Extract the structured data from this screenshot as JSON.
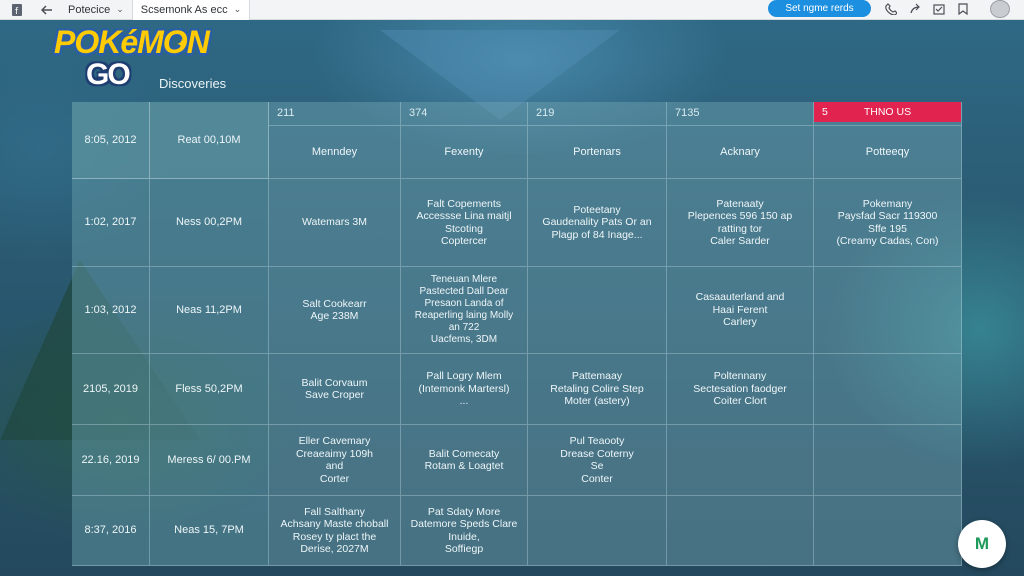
{
  "browser": {
    "tabs": [
      {
        "label": "Potecice"
      },
      {
        "label": "Scsemonk As ecc"
      }
    ],
    "action_label": "Set ngme rerds"
  },
  "logo": {
    "line1": "POKéMON",
    "line2": "GO"
  },
  "page": {
    "title": "Discoveries"
  },
  "table": {
    "top_numbers": [
      "211",
      "374",
      "219",
      "7135"
    ],
    "alert": {
      "number": "5",
      "label": "THNO US"
    },
    "headers": [
      "Menndey",
      "Fexenty",
      "Portenars",
      "Acknary",
      "Potteeqy"
    ],
    "rows": [
      {
        "date": "8:05, 2012",
        "time": "Reat 00,10M",
        "cells": [
          "",
          "",
          "",
          "",
          ""
        ]
      },
      {
        "date": "1:02, 2017",
        "time": "Ness 00,2PM",
        "cells": [
          "Watemars 3M",
          "Falt Copements\nAccessse Lina maitjl\nStcoting\nCoptercer",
          "Poteetany\nGaudenality Pats Or an\nPlagp of 84 Inage...",
          "Patenaaty\nPlepences 596 150 ap\nratting tor\nCaler Sarder",
          "Pokemany\nPaysfad Sacr 119300\nSffe 195\n(Creamy Cadas, Con)"
        ]
      },
      {
        "date": "1:03, 2012",
        "time": "Neas 11,2PM",
        "cells": [
          "Salt Cookearr\nAge 238M",
          "Teneuan Mlere\nPastected Dall Dear\nPresaon Landa of\nReaperling laing Molly\nan 722\nUacfems, 3DM",
          "",
          "Casaauterland and\nHaai Ferent\nCarlery",
          ""
        ]
      },
      {
        "date": "2105, 2019",
        "time": "Fless 50,2PM",
        "cells": [
          "Balit Corvaum\nSave Croper",
          "Pall Logry Mlem\n(Intemonk Martersl)\n...",
          "Pattemaay\nRetaling Colire Step\nMoter (astery)",
          "Poltennany\nSectesation faodger\nCoiter Clort",
          ""
        ]
      },
      {
        "date": "22.16, 2019",
        "time": "Meress 6/ 00.PM",
        "cells": [
          "Eller Cavemary\nCreaeaimy 109h\nand\nCorter",
          "Balit Comecaty\nRotam & Loagtet",
          "Pul Teaooty\nDrease Coterny\nSe\nConter",
          "",
          ""
        ]
      },
      {
        "date": "8:37, 2016",
        "time": "Neas 15, 7PM",
        "cells": [
          "Fall Salthany\nAchsany Maste choball\nRosey ty plact the\nDerise, 2027M",
          "Pat Sdaty More\nDatemore Speds Clare\nInuide,\nSoffiegp",
          "",
          "",
          ""
        ]
      }
    ]
  },
  "fab": {
    "label": "M"
  }
}
